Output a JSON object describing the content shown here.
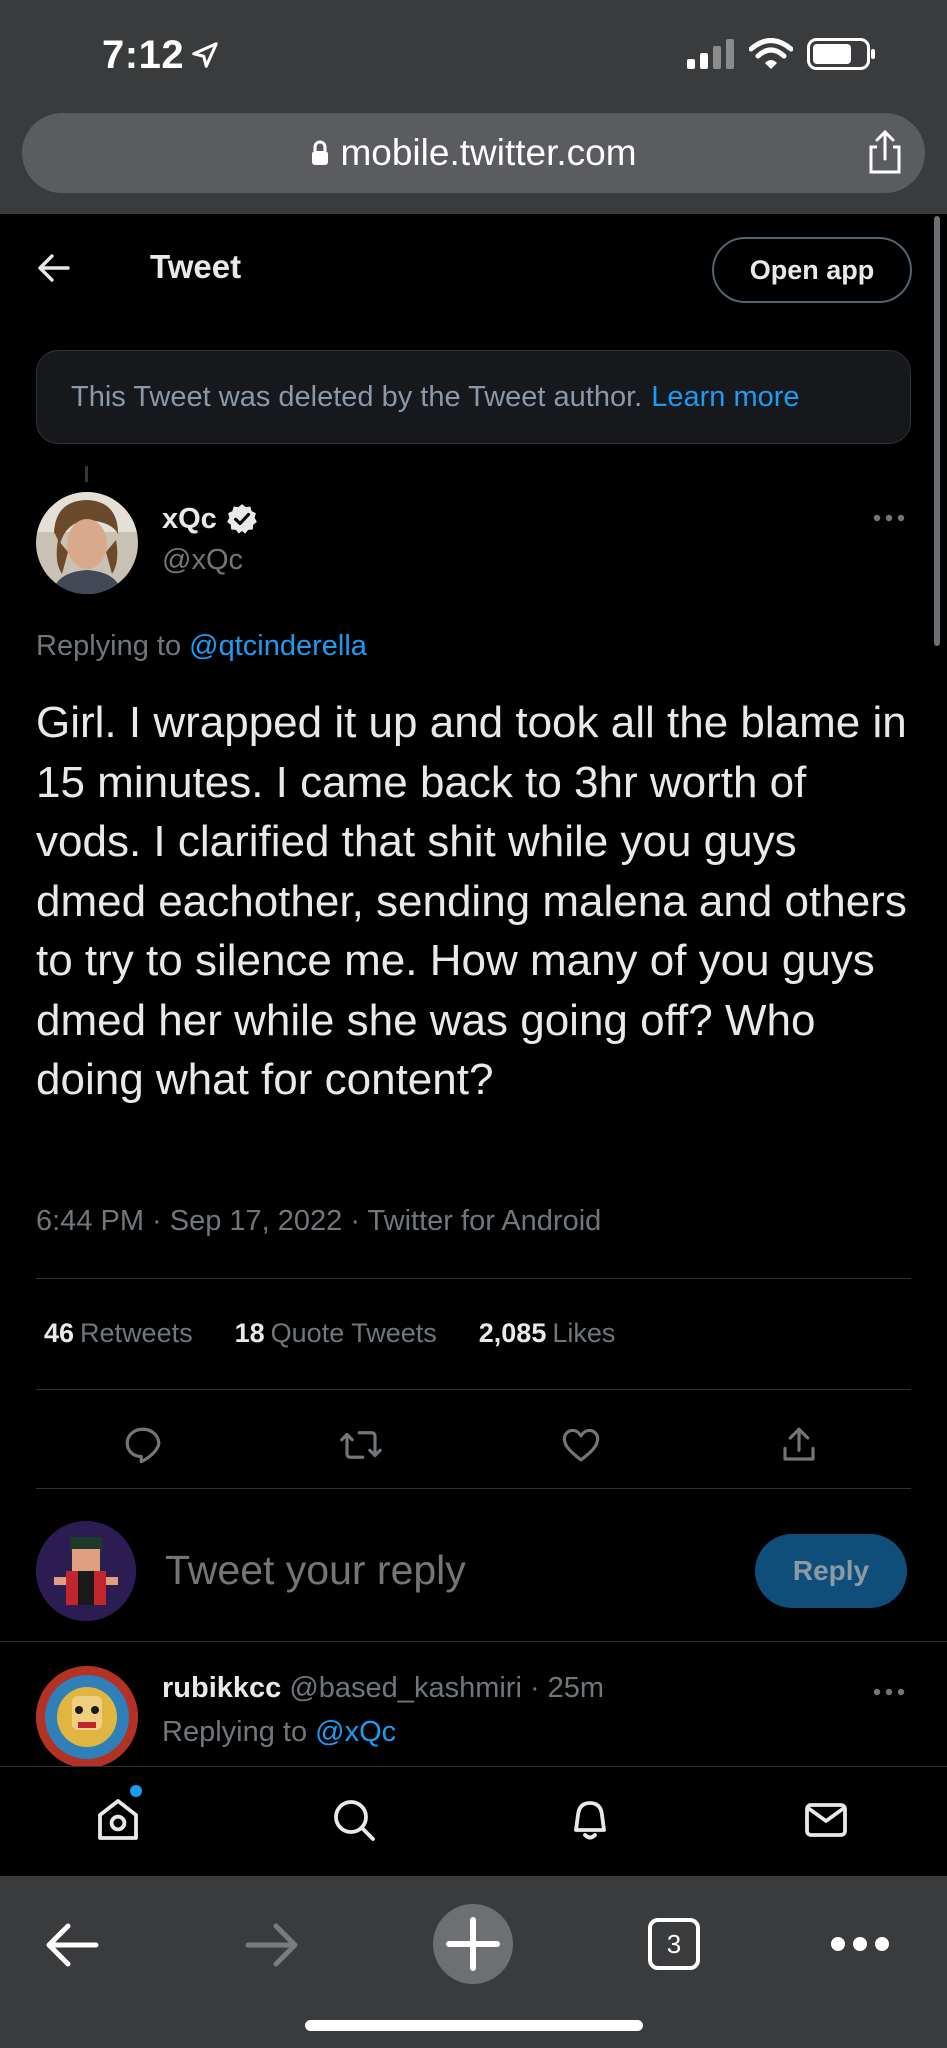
{
  "status_bar": {
    "time": "7:12"
  },
  "browser": {
    "url": "mobile.twitter.com",
    "tab_count": "3"
  },
  "header": {
    "title": "Tweet",
    "open_app_label": "Open app"
  },
  "deleted_notice": {
    "text": "This Tweet was deleted by the Tweet author.",
    "link": "Learn more"
  },
  "tweet": {
    "author_name": "xQc",
    "author_handle": "@xQc",
    "replying_prefix": "Replying to",
    "replying_to": "@qtcinderella",
    "text": "Girl. I wrapped it up and took all the blame in 15 minutes. I came back to 3hr worth of vods. I clarified that shit while you guys dmed eachother, sending malena and others to try to silence me. How many of you guys dmed her while she was going off? Who doing what for content?",
    "timestamp": "6:44 PM · Sep 17, 2022 · Twitter for Android",
    "stats": {
      "retweets_count": "46",
      "retweets_label": "Retweets",
      "quotes_count": "18",
      "quotes_label": "Quote Tweets",
      "likes_count": "2,085",
      "likes_label": "Likes"
    }
  },
  "composer": {
    "placeholder": "Tweet your reply",
    "reply_label": "Reply"
  },
  "next_reply": {
    "name": "rubikkcc",
    "handle_time": "@based_kashmiri · 25m",
    "replying_prefix": "Replying to",
    "replying_to": "@xQc"
  },
  "colors": {
    "accent": "#1d9bf0",
    "background": "#000000",
    "muted": "#71767b"
  },
  "icons": [
    "location-arrow-icon",
    "signal-icon",
    "wifi-icon",
    "battery-icon",
    "lock-icon",
    "share-icon",
    "back-arrow-icon",
    "verified-badge-icon",
    "more-icon",
    "reply-icon",
    "retweet-icon",
    "like-icon",
    "share-tweet-icon",
    "home-icon",
    "search-icon",
    "notifications-icon",
    "messages-icon",
    "browser-back-icon",
    "browser-forward-icon",
    "new-tab-icon",
    "tabs-icon",
    "browser-more-icon"
  ]
}
